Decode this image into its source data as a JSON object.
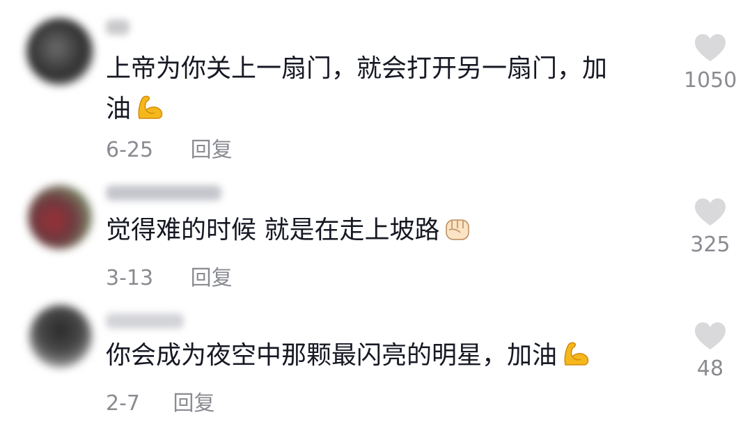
{
  "comments": [
    {
      "text_line1": "上帝为你关上一扇门，就会打开另一扇门，加",
      "text_line2": "油",
      "emoji": "flexed-biceps",
      "date": "6-25",
      "reply_label": "回复",
      "likes": "1050"
    },
    {
      "text_line1": "觉得难的时候 就是在走上坡路",
      "emoji": "raised-fist",
      "date": "3-13",
      "reply_label": "回复",
      "likes": "325"
    },
    {
      "text_line1": "你会成为夜空中那颗最闪亮的明星，加油",
      "emoji": "flexed-biceps",
      "date": "2-7",
      "reply_label": "回复",
      "likes": "48"
    }
  ],
  "colors": {
    "text": "#161823",
    "meta": "#8a8b91",
    "heart": "#d9d9dc",
    "emoji": "#f5b81c"
  }
}
